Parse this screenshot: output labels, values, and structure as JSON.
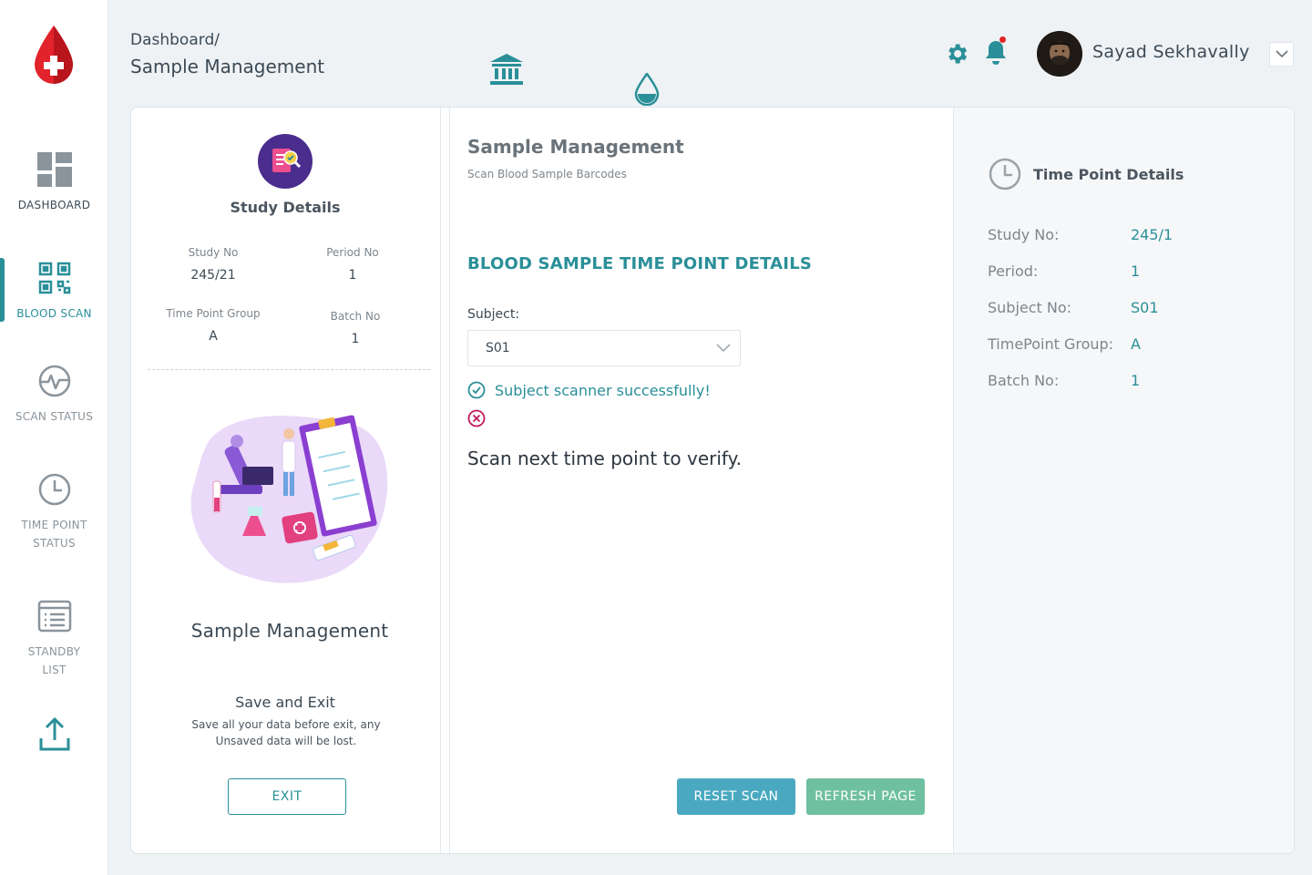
{
  "sidebar": {
    "items": [
      {
        "label": "DASHBOARD",
        "icon": "dashboard-icon"
      },
      {
        "label": "BLOOD SCAN",
        "icon": "qr-code-icon"
      },
      {
        "label": "SCAN STATUS",
        "icon": "pulse-icon"
      },
      {
        "label": "TIME POINT\nSTATUS",
        "icon": "clock-icon"
      },
      {
        "label": "STANDBY\nLIST",
        "icon": "list-icon"
      },
      {
        "label": "",
        "icon": "upload-icon"
      }
    ],
    "active": "BLOOD SCAN"
  },
  "header": {
    "breadcrumb_root": "Dashboard/",
    "breadcrumb_page": "Sample Management",
    "username": "Sayad Sekhavally"
  },
  "study": {
    "title": "Study Details",
    "fields": [
      {
        "label": "Study No",
        "value": "245/21"
      },
      {
        "label": "Period No",
        "value": "1"
      },
      {
        "label": "Time Point Group",
        "value": "A"
      },
      {
        "label": "Batch No",
        "value": "1"
      }
    ],
    "module_title": "Sample Management",
    "save_title": "Save and Exit",
    "save_note": "Save all your data before exit, any Unsaved data will be lost.",
    "exit_label": "EXIT"
  },
  "main": {
    "title": "Sample Management",
    "subtitle": "Scan Blood Sample Barcodes",
    "section_heading": "BLOOD SAMPLE TIME POINT DETAILS",
    "subject_label": "Subject:",
    "subject_value": "S01",
    "success_message": "Subject scanner successfully!",
    "next_message": "Scan next time point to verify.",
    "reset_label": "RESET SCAN",
    "refresh_label": "REFRESH PAGE"
  },
  "time_point": {
    "title": "Time Point Details",
    "rows": [
      {
        "label": "Study No:",
        "value": "245/1"
      },
      {
        "label": "Period:",
        "value": "1"
      },
      {
        "label": "Subject No:",
        "value": "S01"
      },
      {
        "label": "TimePoint Group:",
        "value": "A"
      },
      {
        "label": "Batch No:",
        "value": "1"
      }
    ]
  },
  "colors": {
    "accent": "#2a8f98",
    "reset_button": "#4aa9c1",
    "refresh_button": "#6fc0a0",
    "error": "#c2185b",
    "brand_red": "#e2232b"
  }
}
